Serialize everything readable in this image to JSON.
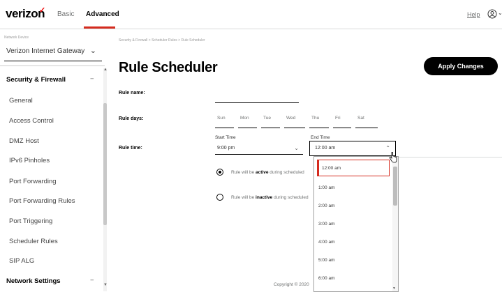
{
  "header": {
    "logo": "verizon",
    "logo_mark": "✓",
    "tabs": [
      {
        "label": "Basic",
        "active": false
      },
      {
        "label": "Advanced",
        "active": true
      }
    ],
    "help": "Help",
    "user_icon": "user-circle-icon",
    "accent_color": "#d52b1e"
  },
  "sidebar": {
    "device_label": "Network Device",
    "device_value": "Verizon Internet Gateway",
    "section_security": "Security & Firewall",
    "section_security_toggle": "−",
    "items": [
      "General",
      "Access Control",
      "DMZ Host",
      "IPv6 Pinholes",
      "Port Forwarding",
      "Port Forwarding Rules",
      "Port Triggering",
      "Scheduler Rules",
      "SIP ALG"
    ],
    "section_network": "Network Settings",
    "section_network_toggle": "−"
  },
  "main": {
    "breadcrumb": "Security & Firewall  >  Scheduler Rules  >  Rule Scheduler",
    "title": "Rule Scheduler",
    "apply_button": "Apply Changes",
    "rule_name_label": "Rule name:",
    "rule_name_value": "",
    "rule_days_label": "Rule days:",
    "days": [
      "Sun",
      "Mon",
      "Tue",
      "Wed",
      "Thu",
      "Fri",
      "Sat"
    ],
    "rule_time_label": "Rule time:",
    "start_time_label": "Start Time",
    "start_time_value": "9:00 pm",
    "end_time_label": "End Time",
    "end_time_value": "12:00 am",
    "radio_active_pre": "Rule will be ",
    "radio_active_bold": "active",
    "radio_active_post": " during scheduled",
    "radio_inactive_pre": "Rule will be ",
    "radio_inactive_bold": "inactive",
    "radio_inactive_post": " during scheduled",
    "footer": "Copyright © 2020"
  },
  "dropdown": {
    "options": [
      "12:00 am",
      "1:00 am",
      "2:00 am",
      "3:00 am",
      "4:00 am",
      "5:00 am",
      "6:00 am"
    ],
    "selected_index": 0
  }
}
